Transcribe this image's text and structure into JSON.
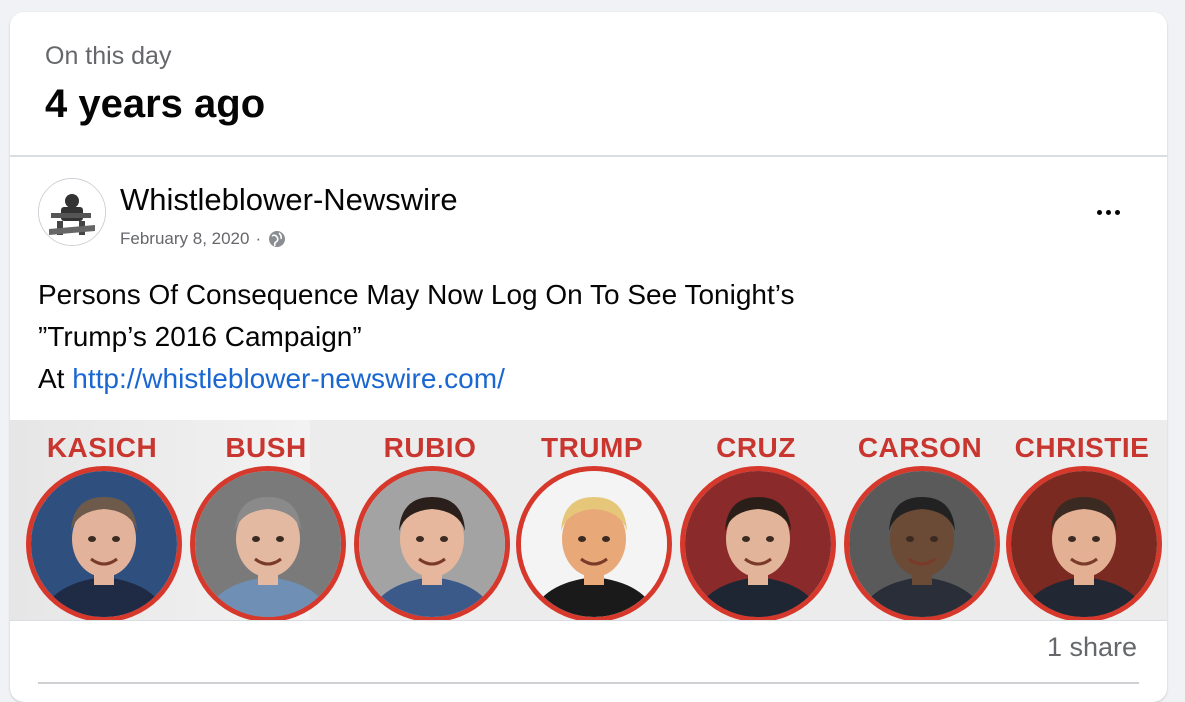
{
  "memory": {
    "label": "On this day",
    "title": "4 years ago"
  },
  "post": {
    "author": "Whistleblower-Newswire",
    "date": "February 8, 2020",
    "separator": "·",
    "privacy_icon": "globe-icon",
    "more_icon": "more-options-icon",
    "text_line1": "Persons Of Consequence May Now Log On To See Tonight’s",
    "text_line2": "”Trump’s 2016 Campaign”",
    "text_prefix": "At",
    "link": "http://whistleblower-newswire.com/"
  },
  "image": {
    "candidates": [
      {
        "name": "KASICH",
        "bg": "#2f4f7f",
        "skin": "#e2b39a",
        "hair": "#6e5a4a",
        "shirt": "#1f2b44"
      },
      {
        "name": "BUSH",
        "bg": "#7a7a7a",
        "skin": "#e4b9a2",
        "hair": "#8a8a8a",
        "shirt": "#6f8fb5"
      },
      {
        "name": "RUBIO",
        "bg": "#a3a3a3",
        "skin": "#e6b79c",
        "hair": "#2a1f1a",
        "shirt": "#3b5a8a"
      },
      {
        "name": "TRUMP",
        "bg": "#f4f4f4",
        "skin": "#e8a878",
        "hair": "#e6c77a",
        "shirt": "#1a1a1a"
      },
      {
        "name": "CRUZ",
        "bg": "#8a2a2a",
        "skin": "#e2b49a",
        "hair": "#2a1e18",
        "shirt": "#1e2533"
      },
      {
        "name": "CARSON",
        "bg": "#5a5a5a",
        "skin": "#6b4a36",
        "hair": "#222222",
        "shirt": "#2a2e38"
      },
      {
        "name": "CHRISTIE",
        "bg": "#7a2a20",
        "skin": "#e4b094",
        "hair": "#3a2a22",
        "shirt": "#222833"
      }
    ],
    "accent_color": "#d7382c"
  },
  "footer": {
    "shares": "1 share"
  }
}
